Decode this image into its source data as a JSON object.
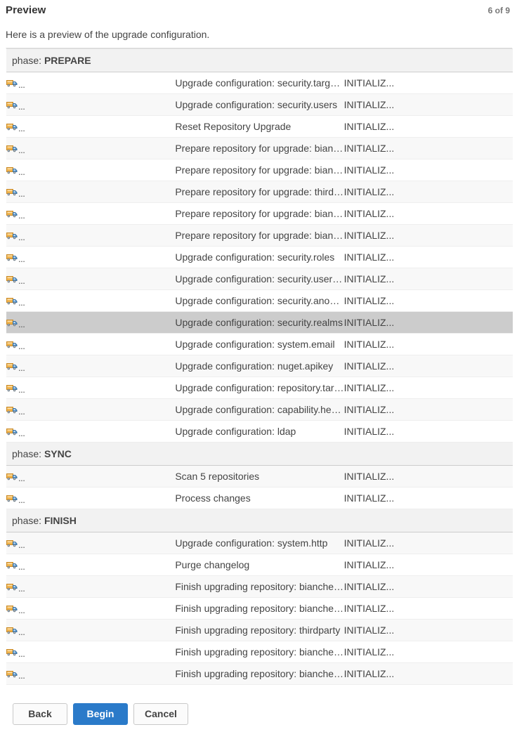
{
  "wizard": {
    "title": "Preview",
    "step_indicator": "6 of 9",
    "description": "Here is a preview of the upgrade configuration.",
    "buttons": {
      "back": "Back",
      "begin": "Begin",
      "cancel": "Cancel"
    },
    "colors": {
      "primary_button": "#2a7ac9",
      "phase_header_bg": "#f2f2f2",
      "selected_row_bg": "#cccccc",
      "stripe_bg": "#f8f8f8",
      "icon_body": "#f0ad4e",
      "icon_cab": "#5b9bd5"
    }
  },
  "table": {
    "icon_name": "truck-icon",
    "icon_ellipsis": "...",
    "groups": [
      {
        "phase_label": "phase: ",
        "phase_name": "PREPARE",
        "rows": [
          {
            "name": "Upgrade configuration: security.target-privileges",
            "status": "INITIALIZ...",
            "selected": false
          },
          {
            "name": "Upgrade configuration: security.users",
            "status": "INITIALIZ...",
            "selected": false
          },
          {
            "name": "Reset Repository Upgrade",
            "status": "INITIALIZ...",
            "selected": false
          },
          {
            "name": "Prepare repository for upgrade: bianchengbang_central_proxy",
            "status": "INITIALIZ...",
            "selected": false
          },
          {
            "name": "Prepare repository for upgrade: bianchengbang_Release_hosted",
            "status": "INITIALIZ...",
            "selected": false
          },
          {
            "name": "Prepare repository for upgrade: thirdparty",
            "status": "INITIALIZ...",
            "selected": false
          },
          {
            "name": "Prepare repository for upgrade: bianchengbang_repository_group",
            "status": "INITIALIZ...",
            "selected": false
          },
          {
            "name": "Prepare repository for upgrade: bianchengbang_Snapshot_hosted",
            "status": "INITIALIZ...",
            "selected": false
          },
          {
            "name": "Upgrade configuration: security.roles",
            "status": "INITIALIZ...",
            "selected": false
          },
          {
            "name": "Upgrade configuration: security.user-role-mappings",
            "status": "INITIALIZ...",
            "selected": false
          },
          {
            "name": "Upgrade configuration: security.anonymous",
            "status": "INITIALIZ...",
            "selected": false
          },
          {
            "name": "Upgrade configuration: security.realms",
            "status": "INITIALIZ...",
            "selected": true
          },
          {
            "name": "Upgrade configuration: system.email",
            "status": "INITIALIZ...",
            "selected": false
          },
          {
            "name": "Upgrade configuration: nuget.apikey",
            "status": "INITIALIZ...",
            "selected": false
          },
          {
            "name": "Upgrade configuration: repository.targets",
            "status": "INITIALIZ...",
            "selected": false
          },
          {
            "name": "Upgrade configuration: capability.healthcheck",
            "status": "INITIALIZ...",
            "selected": false
          },
          {
            "name": "Upgrade configuration: ldap",
            "status": "INITIALIZ...",
            "selected": false
          }
        ]
      },
      {
        "phase_label": "phase: ",
        "phase_name": "SYNC",
        "rows": [
          {
            "name": "Scan 5 repositories",
            "status": "INITIALIZ...",
            "selected": false
          },
          {
            "name": "Process changes",
            "status": "INITIALIZ...",
            "selected": false
          }
        ]
      },
      {
        "phase_label": "phase: ",
        "phase_name": "FINISH",
        "rows": [
          {
            "name": "Upgrade configuration: system.http",
            "status": "INITIALIZ...",
            "selected": false
          },
          {
            "name": "Purge changelog",
            "status": "INITIALIZ...",
            "selected": false
          },
          {
            "name": "Finish upgrading repository: bianchengbang_central_proxy",
            "status": "INITIALIZ...",
            "selected": false
          },
          {
            "name": "Finish upgrading repository: bianchengbang_Release_hosted",
            "status": "INITIALIZ...",
            "selected": false
          },
          {
            "name": "Finish upgrading repository: thirdparty",
            "status": "INITIALIZ...",
            "selected": false
          },
          {
            "name": "Finish upgrading repository: bianchengbang_repository_group",
            "status": "INITIALIZ...",
            "selected": false
          },
          {
            "name": "Finish upgrading repository: bianchengbang_Snapshot_hosted",
            "status": "INITIALIZ...",
            "selected": false
          }
        ]
      }
    ]
  }
}
